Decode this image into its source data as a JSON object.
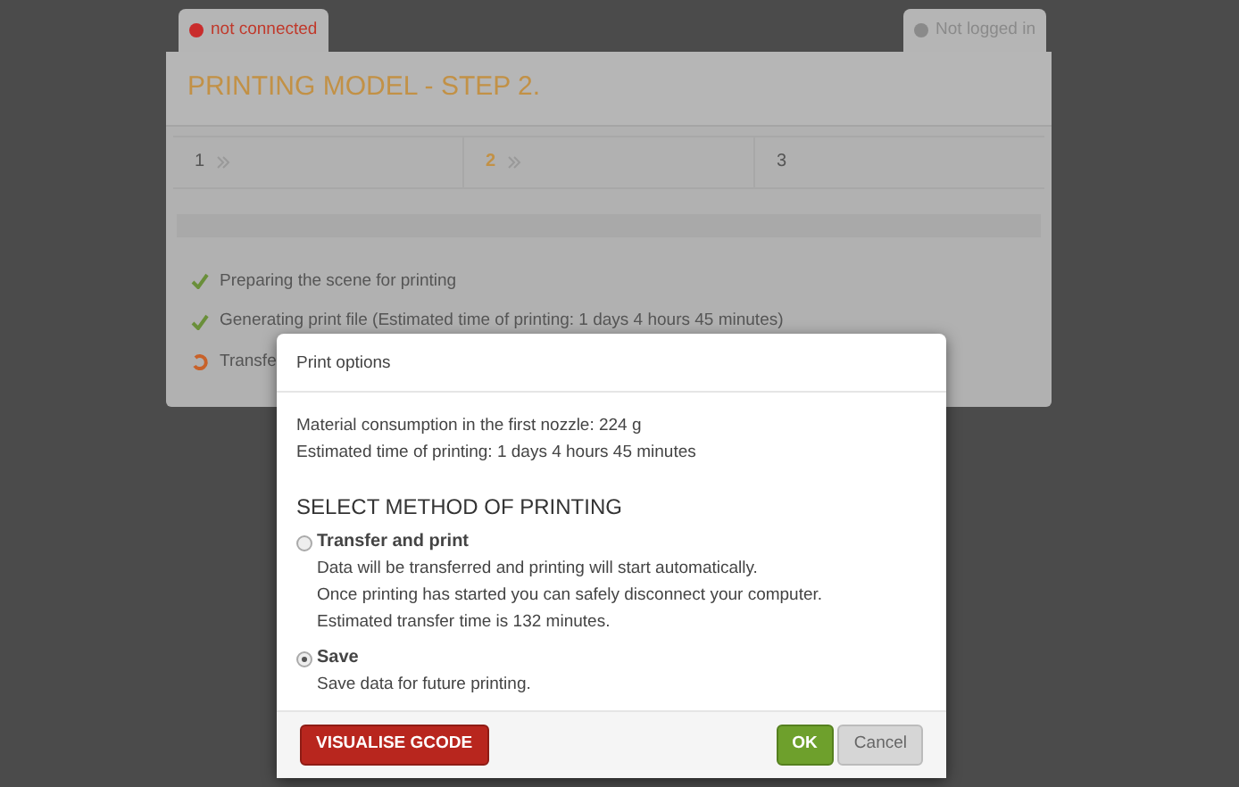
{
  "connection": {
    "label": "not connected",
    "connected": false
  },
  "login": {
    "label": "Not logged in",
    "logged_in": false
  },
  "panel": {
    "title": "PRINTING MODEL - STEP 2.",
    "steps": [
      {
        "label": "1",
        "selected": false
      },
      {
        "label": "2",
        "selected": true
      },
      {
        "label": "3",
        "selected": false
      }
    ],
    "progress": {
      "level": 0
    },
    "tasks": [
      {
        "kind": "done",
        "label": "Preparing the scene for printing"
      },
      {
        "kind": "done",
        "label": "Generating print file (Estimated time of printing: 1 days 4 hours 45 minutes)"
      },
      {
        "kind": "progress",
        "label": "Transfe"
      }
    ]
  },
  "dialog": {
    "title": "Print options",
    "info": [
      "Material consumption in the first nozzle: 224 g",
      "Estimated time of printing: 1 days 4 hours 45 minutes"
    ],
    "heading": "SELECT METHOD OF PRINTING",
    "options": [
      {
        "label": "Transfer and print",
        "selected": false,
        "lines": [
          "Data will be transferred and printing will start automatically.",
          "Once printing has started you can safely disconnect your computer.",
          "Estimated transfer time is 132 minutes."
        ]
      },
      {
        "label": "Save",
        "selected": true,
        "lines": [
          "Save data for future printing."
        ]
      }
    ],
    "visualise_button": "VISUALISE GCODE",
    "ok_button": "OK",
    "cancel_button": "Cancel"
  }
}
